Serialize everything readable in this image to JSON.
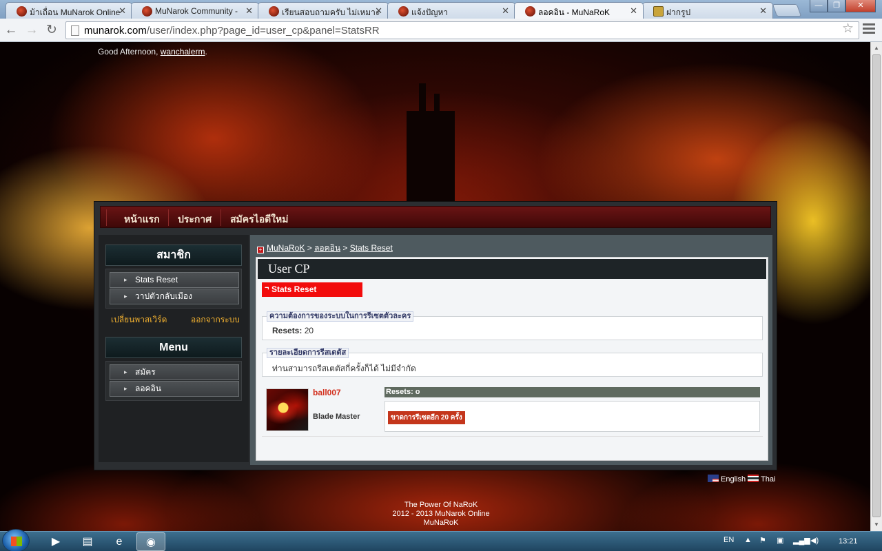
{
  "browser": {
    "tabs": [
      {
        "title": "ม้าเถื่อน MuNarok Online"
      },
      {
        "title": "MuNarok Community -"
      },
      {
        "title": "เรียนสอบถามครับ ไม่เหมาะ"
      },
      {
        "title": "แจ้งปัญหา"
      },
      {
        "title": "ลอคอิน - MuNaRoK"
      },
      {
        "title": "ฝากรูป"
      }
    ],
    "url_host": "munarok.com",
    "url_path": "/user/index.php?page_id=user_cp&panel=StatsRR"
  },
  "page": {
    "greeting_prefix": "Good Afternoon,",
    "username": "wanchalerm",
    "greeting_suffix": ".",
    "nav": [
      "หน้าแรก",
      "ประกาศ",
      "สมัครไอดีใหม่"
    ],
    "member_box": {
      "title": "สมาชิก",
      "items": [
        "Stats Reset",
        "วาปตัวกลับเมือง"
      ],
      "change_password": "เปลี่ยนพาสเวิร์ด",
      "logout": "ออกจากระบบ"
    },
    "menu_box": {
      "title": "Menu",
      "items": [
        "สมัคร",
        "ลอคอิน"
      ]
    },
    "breadcrumb": [
      "MuNaRoK",
      ">",
      "ลอคอิน",
      ">",
      "Stats Reset"
    ],
    "cp_title": "User CP",
    "active_tab": "Stats Reset",
    "requirements": {
      "legend": "ความต้องการของระบบในการรีเซตตัวละคร",
      "label": "Resets:",
      "value": "20"
    },
    "details": {
      "legend": "รายละเอียดการรีสเตตัส",
      "text": "ท่านสามารถรีสเตตัสกี่ครั้งก็ได้ ไม่มีจำกัด"
    },
    "character": {
      "name": "ball007",
      "class": "Blade Master",
      "resets_label": "Resets: o",
      "warning": "ขาดการรีเซตอีก 20 ครั้ง"
    },
    "languages": [
      "English",
      "Thai"
    ],
    "footer": [
      "The Power Of NaRoK",
      "2012 - 2013 MuNarok Online",
      "MuNaRoK"
    ]
  },
  "taskbar": {
    "lang": "EN",
    "clock": "13:21"
  }
}
